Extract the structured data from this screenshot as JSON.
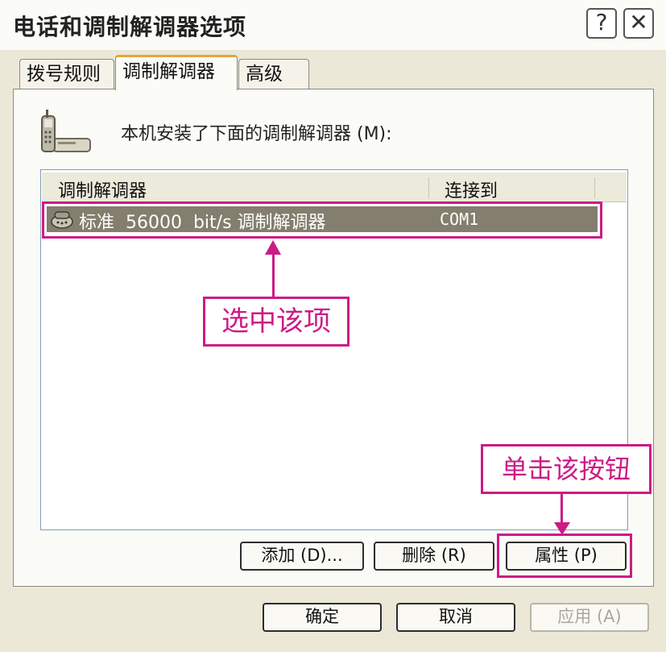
{
  "window": {
    "title": "电话和调制解调器选项",
    "help_glyph": "?",
    "close_glyph": "✕"
  },
  "tabs": [
    {
      "label": "拨号规则",
      "active": false
    },
    {
      "label": "调制解调器",
      "active": true
    },
    {
      "label": "高级",
      "active": false
    }
  ],
  "panel": {
    "intro_text": "本机安装了下面的调制解调器 (M):",
    "icon": "phone-modem-icon"
  },
  "table": {
    "columns": [
      "调制解调器",
      "连接到"
    ],
    "rows": [
      {
        "name": "标准  56000  bit/s 调制解调器",
        "port": "COM1",
        "selected": true,
        "icon": "modem-icon"
      }
    ]
  },
  "buttons": {
    "add": "添加 (D)...",
    "remove": "删除 (R)",
    "properties": "属性 (P)",
    "ok": "确定",
    "cancel": "取消",
    "apply": "应用 (A)"
  },
  "annotations": {
    "select_item": "选中该项",
    "click_button": "单击该按钮",
    "color": "#cc1b86"
  }
}
